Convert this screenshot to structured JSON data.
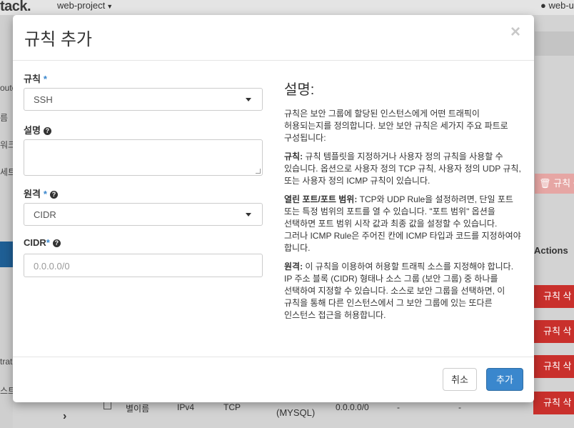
{
  "background": {
    "logo": "tack.",
    "project": "web-project",
    "user": "web-u",
    "sidebar_items": [
      "oute",
      "름",
      "워크",
      "세트",
      "trat",
      "스트"
    ],
    "delete_top_label": "규칙 삭",
    "actions_header": "Actions",
    "delete_label": "규칙 삭",
    "row": {
      "name": "별이름",
      "ethertype": "IPv4",
      "protocol": "TCP",
      "port": "(MYSQL)",
      "range": "0.0.0.0/0",
      "dash1": "-",
      "dash2": "-"
    }
  },
  "modal": {
    "title": "규칙 추가",
    "close": "×"
  },
  "form": {
    "rule_label": "규칙",
    "rule_value": "SSH",
    "desc_label": "설명",
    "remote_label": "원격",
    "remote_value": "CIDR",
    "cidr_label": "CIDR",
    "cidr_placeholder": "0.0.0.0/0",
    "required_mark": "*"
  },
  "description": {
    "title": "설명:",
    "intro": "규칙은 보안 그룹에 할당된 인스턴스에게 어떤 트래픽이 허용되는지를 정의합니다. 보안 보안 규칙은 세가지 주요 파트로 구성됩니다:",
    "rule_term": "규칙:",
    "rule_text": " 규칙 템플릿을 지정하거나 사용자 정의 규칙을 사용할 수 있습니다. 옵션으로 사용자 정의 TCP 규칙, 사용자 정의 UDP 규칙, 또는 사용자 정의 ICMP 규칙이 있습니다.",
    "port_term": "열린 포트/포트 범위:",
    "port_text": " TCP와 UDP Rule을 설정하려면, 단일 포트 또는 특정 범위의 포트를 열 수 있습니다. \"포트 범위\" 옵션을 선택하면 포트 범위 시작 값과 최종 값을 설정할 수 있습니다. 그러나 ICMP Rule은 주어진 칸에 ICMP 타입과 코드를 지정하여야 합니다.",
    "remote_term": "원격:",
    "remote_text": " 이 규칙을 이용하여 허용할 트래픽 소스를 지정해야 합니다. IP 주소 블록 (CIDR) 형태나 소스 그룹 (보안 그룹) 중 하나를 선택하여 지정할 수 있습니다. 소스로 보안 그룹을 선택하면, 이 규칙을 통해 다른 인스턴스에서 그 보안 그룹에 있는 또다른 인스턴스 접근을 허용합니다."
  },
  "footer": {
    "cancel": "취소",
    "add": "추가"
  }
}
